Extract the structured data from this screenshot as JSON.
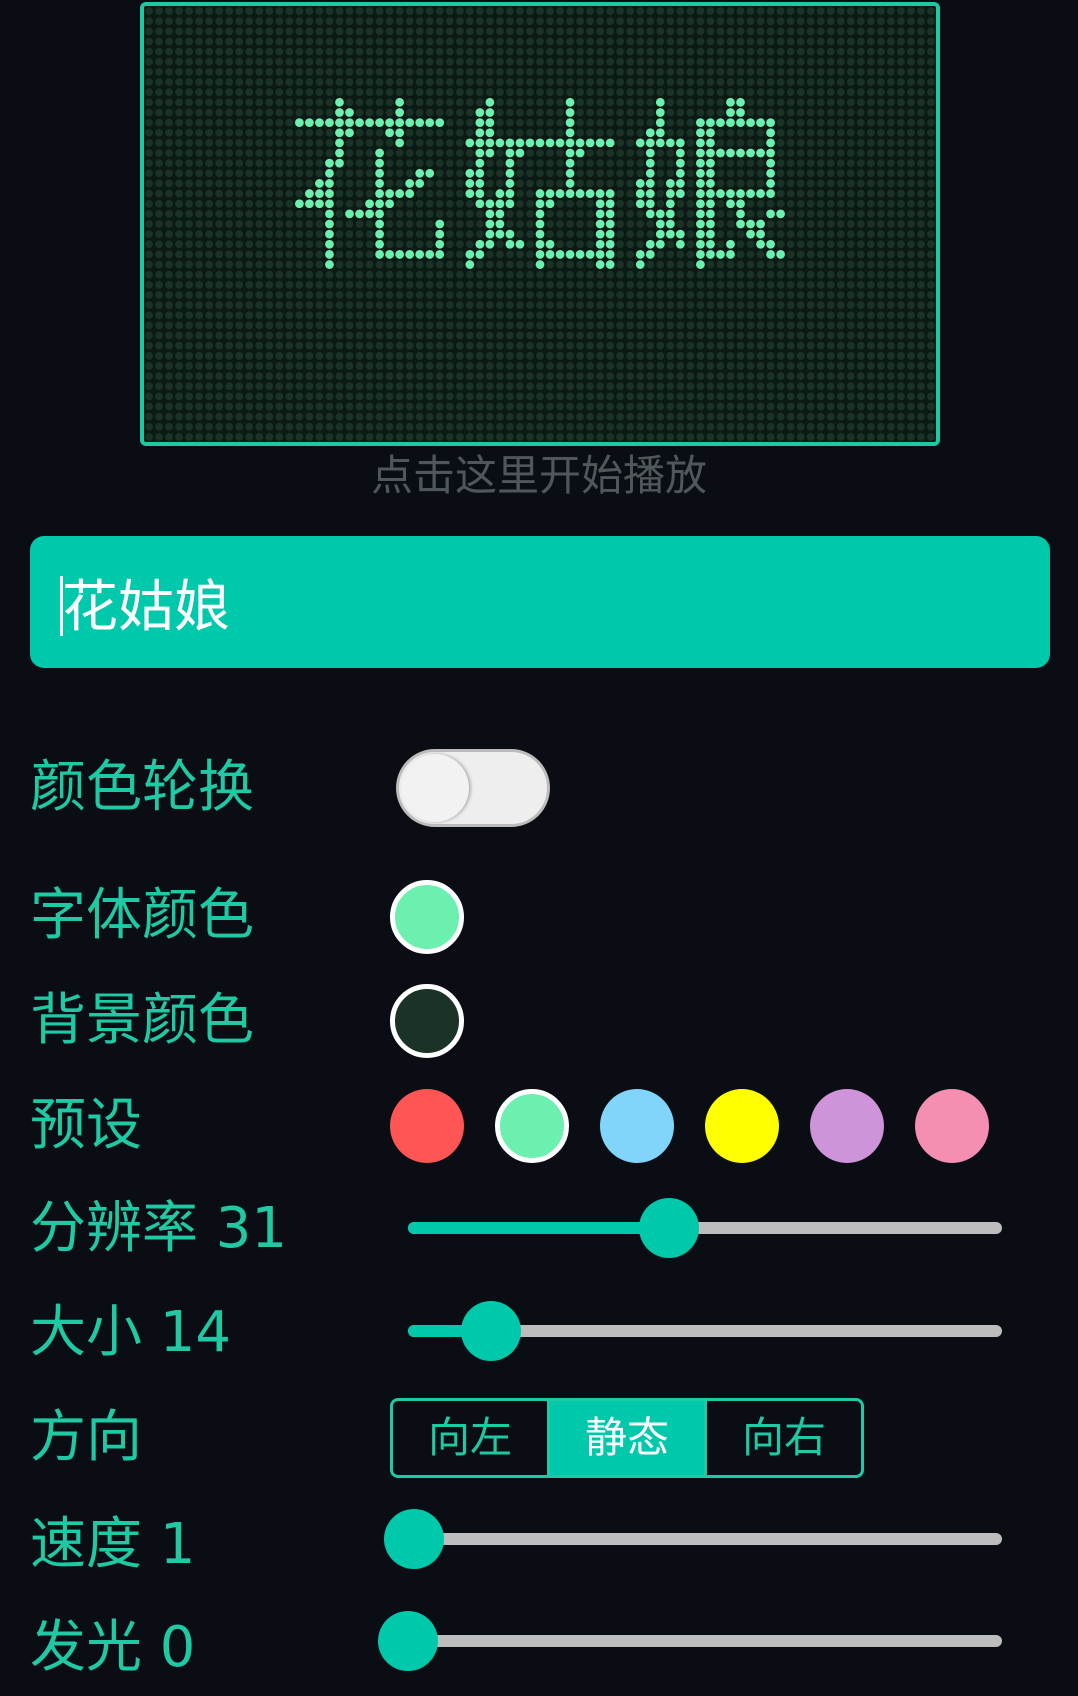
{
  "display": {
    "text": "花姑娘",
    "font_color": "#6cf0b0",
    "bg_color": "#1a3326",
    "hint": "点击这里开始播放"
  },
  "input": {
    "value": "花姑娘"
  },
  "settings": {
    "color_cycle": {
      "label": "颜色轮换",
      "on": false
    },
    "font_color": {
      "label": "字体颜色",
      "color": "#6cf0b0"
    },
    "bg_color": {
      "label": "背景颜色",
      "color": "#1a3326"
    },
    "presets": {
      "label": "预设",
      "colors": [
        "#ff5555",
        "#6cf0b0",
        "#81d4fa",
        "#ffff00",
        "#ce93d8",
        "#f48fb1"
      ],
      "selected_index": 1
    },
    "resolution": {
      "label": "分辨率 31",
      "value": 31,
      "fraction": 0.44
    },
    "size": {
      "label": "大小 14",
      "value": 14,
      "fraction": 0.14
    },
    "direction": {
      "label": "方向",
      "options": [
        "向左",
        "静态",
        "向右"
      ],
      "selected_index": 1
    },
    "speed": {
      "label": "速度 1",
      "value": 1,
      "fraction": 0.0
    },
    "glow": {
      "label": "发光 0",
      "value": 0,
      "fraction": 0.0
    }
  },
  "theme": {
    "accent": "#00c9ab",
    "accent_text": "#1fc9a4",
    "background": "#0a0e14"
  }
}
